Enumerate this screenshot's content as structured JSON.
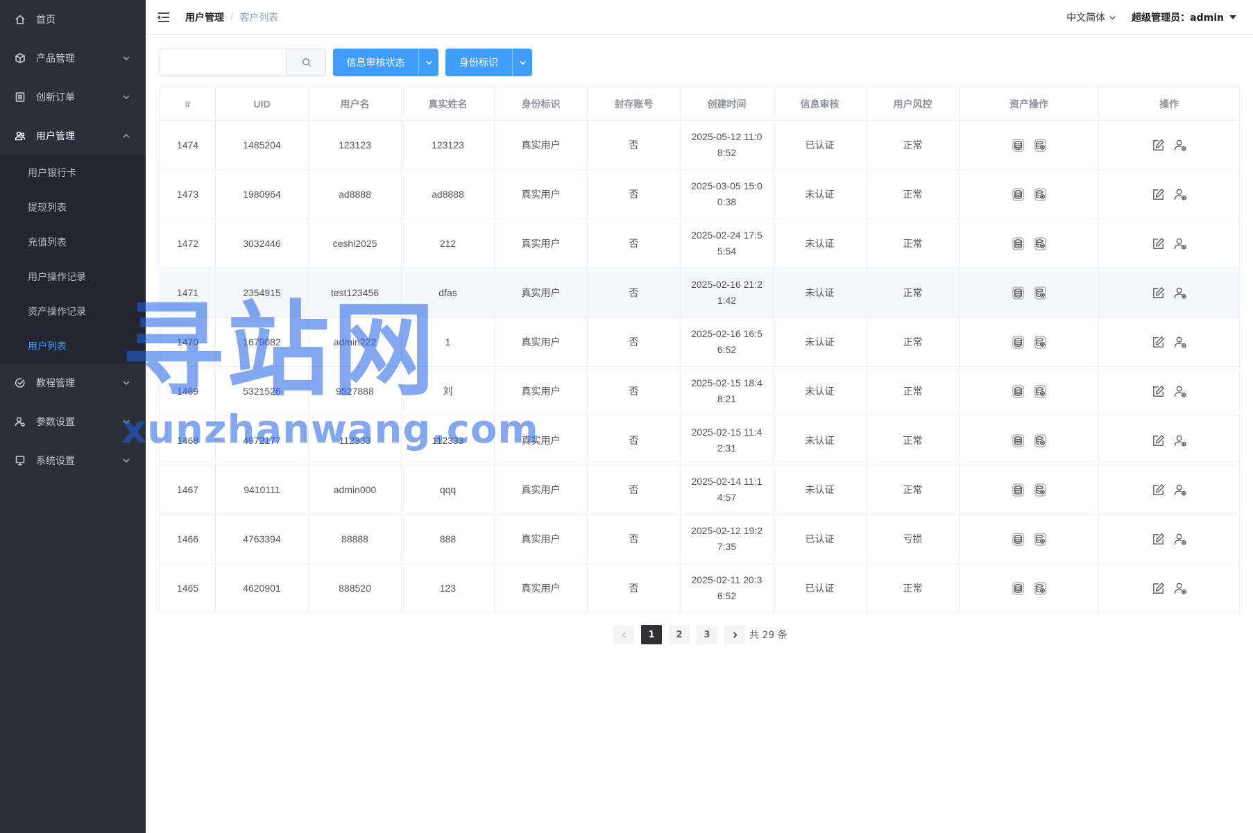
{
  "sidebar": {
    "items": [
      {
        "label": "首页",
        "icon": "home-icon",
        "has_arrow": false
      },
      {
        "label": "产品管理",
        "icon": "cube-icon",
        "has_arrow": true
      },
      {
        "label": "创新订单",
        "icon": "order-icon",
        "has_arrow": true
      },
      {
        "label": "用户管理",
        "icon": "users-icon",
        "has_arrow": true,
        "expanded": true
      },
      {
        "label": "教程管理",
        "icon": "check-circle-icon",
        "has_arrow": true
      },
      {
        "label": "参数设置",
        "icon": "user-gear-icon",
        "has_arrow": true
      },
      {
        "label": "系统设置",
        "icon": "monitor-icon",
        "has_arrow": true
      }
    ],
    "submenu": [
      {
        "label": "用户银行卡"
      },
      {
        "label": "提现列表"
      },
      {
        "label": "充值列表"
      },
      {
        "label": "用户操作记录"
      },
      {
        "label": "资产操作记录"
      },
      {
        "label": "用户列表",
        "active": true
      }
    ],
    "active_color": "#409eff"
  },
  "header": {
    "breadcrumb": [
      "用户管理",
      "客户列表"
    ],
    "breadcrumb_sep": "/",
    "language": "中文简体",
    "user": "超级管理员：admin"
  },
  "toolbar": {
    "search_value": "",
    "audit_button": "信息审核状态",
    "identity_button": "身份标识",
    "button_color": "#409eff"
  },
  "table": {
    "columns": [
      "#",
      "UID",
      "用户名",
      "真实姓名",
      "身份标识",
      "封存账号",
      "创建时间",
      "信息审核",
      "用户风控",
      "资产操作",
      "操作"
    ],
    "rows": [
      {
        "id": "1474",
        "uid": "1485204",
        "username": "123123",
        "realname": "123123",
        "identity": "真实用户",
        "frozen": "否",
        "created": "2025-05-12 11:08:52",
        "audit": "已认证",
        "risk": "正常"
      },
      {
        "id": "1473",
        "uid": "1980964",
        "username": "ad8888",
        "realname": "ad8888",
        "identity": "真实用户",
        "frozen": "否",
        "created": "2025-03-05 15:00:38",
        "audit": "未认证",
        "risk": "正常"
      },
      {
        "id": "1472",
        "uid": "3032446",
        "username": "ceshi2025",
        "realname": "212",
        "identity": "真实用户",
        "frozen": "否",
        "created": "2025-02-24 17:55:54",
        "audit": "未认证",
        "risk": "正常"
      },
      {
        "id": "1471",
        "uid": "2354915",
        "username": "test123456",
        "realname": "dfas",
        "identity": "真实用户",
        "frozen": "否",
        "created": "2025-02-16 21:21:42",
        "audit": "未认证",
        "risk": "正常",
        "hover": true
      },
      {
        "id": "1470",
        "uid": "1679082",
        "username": "admin222",
        "realname": "1",
        "identity": "真实用户",
        "frozen": "否",
        "created": "2025-02-16 16:56:52",
        "audit": "未认证",
        "risk": "正常"
      },
      {
        "id": "1469",
        "uid": "5321526",
        "username": "9527888",
        "realname": "刘",
        "identity": "真实用户",
        "frozen": "否",
        "created": "2025-02-15 18:48:21",
        "audit": "未认证",
        "risk": "正常"
      },
      {
        "id": "1468",
        "uid": "4972177",
        "username": "112333",
        "realname": "112333",
        "identity": "真实用户",
        "frozen": "否",
        "created": "2025-02-15 11:42:31",
        "audit": "未认证",
        "risk": "正常"
      },
      {
        "id": "1467",
        "uid": "9410111",
        "username": "admin000",
        "realname": "qqq",
        "identity": "真实用户",
        "frozen": "否",
        "created": "2025-02-14 11:14:57",
        "audit": "未认证",
        "risk": "正常"
      },
      {
        "id": "1466",
        "uid": "4763394",
        "username": "88888",
        "realname": "888",
        "identity": "真实用户",
        "frozen": "否",
        "created": "2025-02-12 19:27:35",
        "audit": "已认证",
        "risk": "亏损"
      },
      {
        "id": "1465",
        "uid": "4620901",
        "username": "888520",
        "realname": "123",
        "identity": "真实用户",
        "frozen": "否",
        "created": "2025-02-11 20:36:52",
        "audit": "已认证",
        "risk": "正常"
      }
    ],
    "asset_icons": [
      "coins-icon",
      "coins-settings-icon"
    ],
    "action_icons": [
      "edit-icon",
      "user-settings-icon"
    ]
  },
  "pagination": {
    "pages": [
      "1",
      "2",
      "3"
    ],
    "current": "1",
    "total_text": "共 29 条"
  },
  "watermark": {
    "main": "寻站网",
    "sub": "xunzhanwang.com"
  }
}
